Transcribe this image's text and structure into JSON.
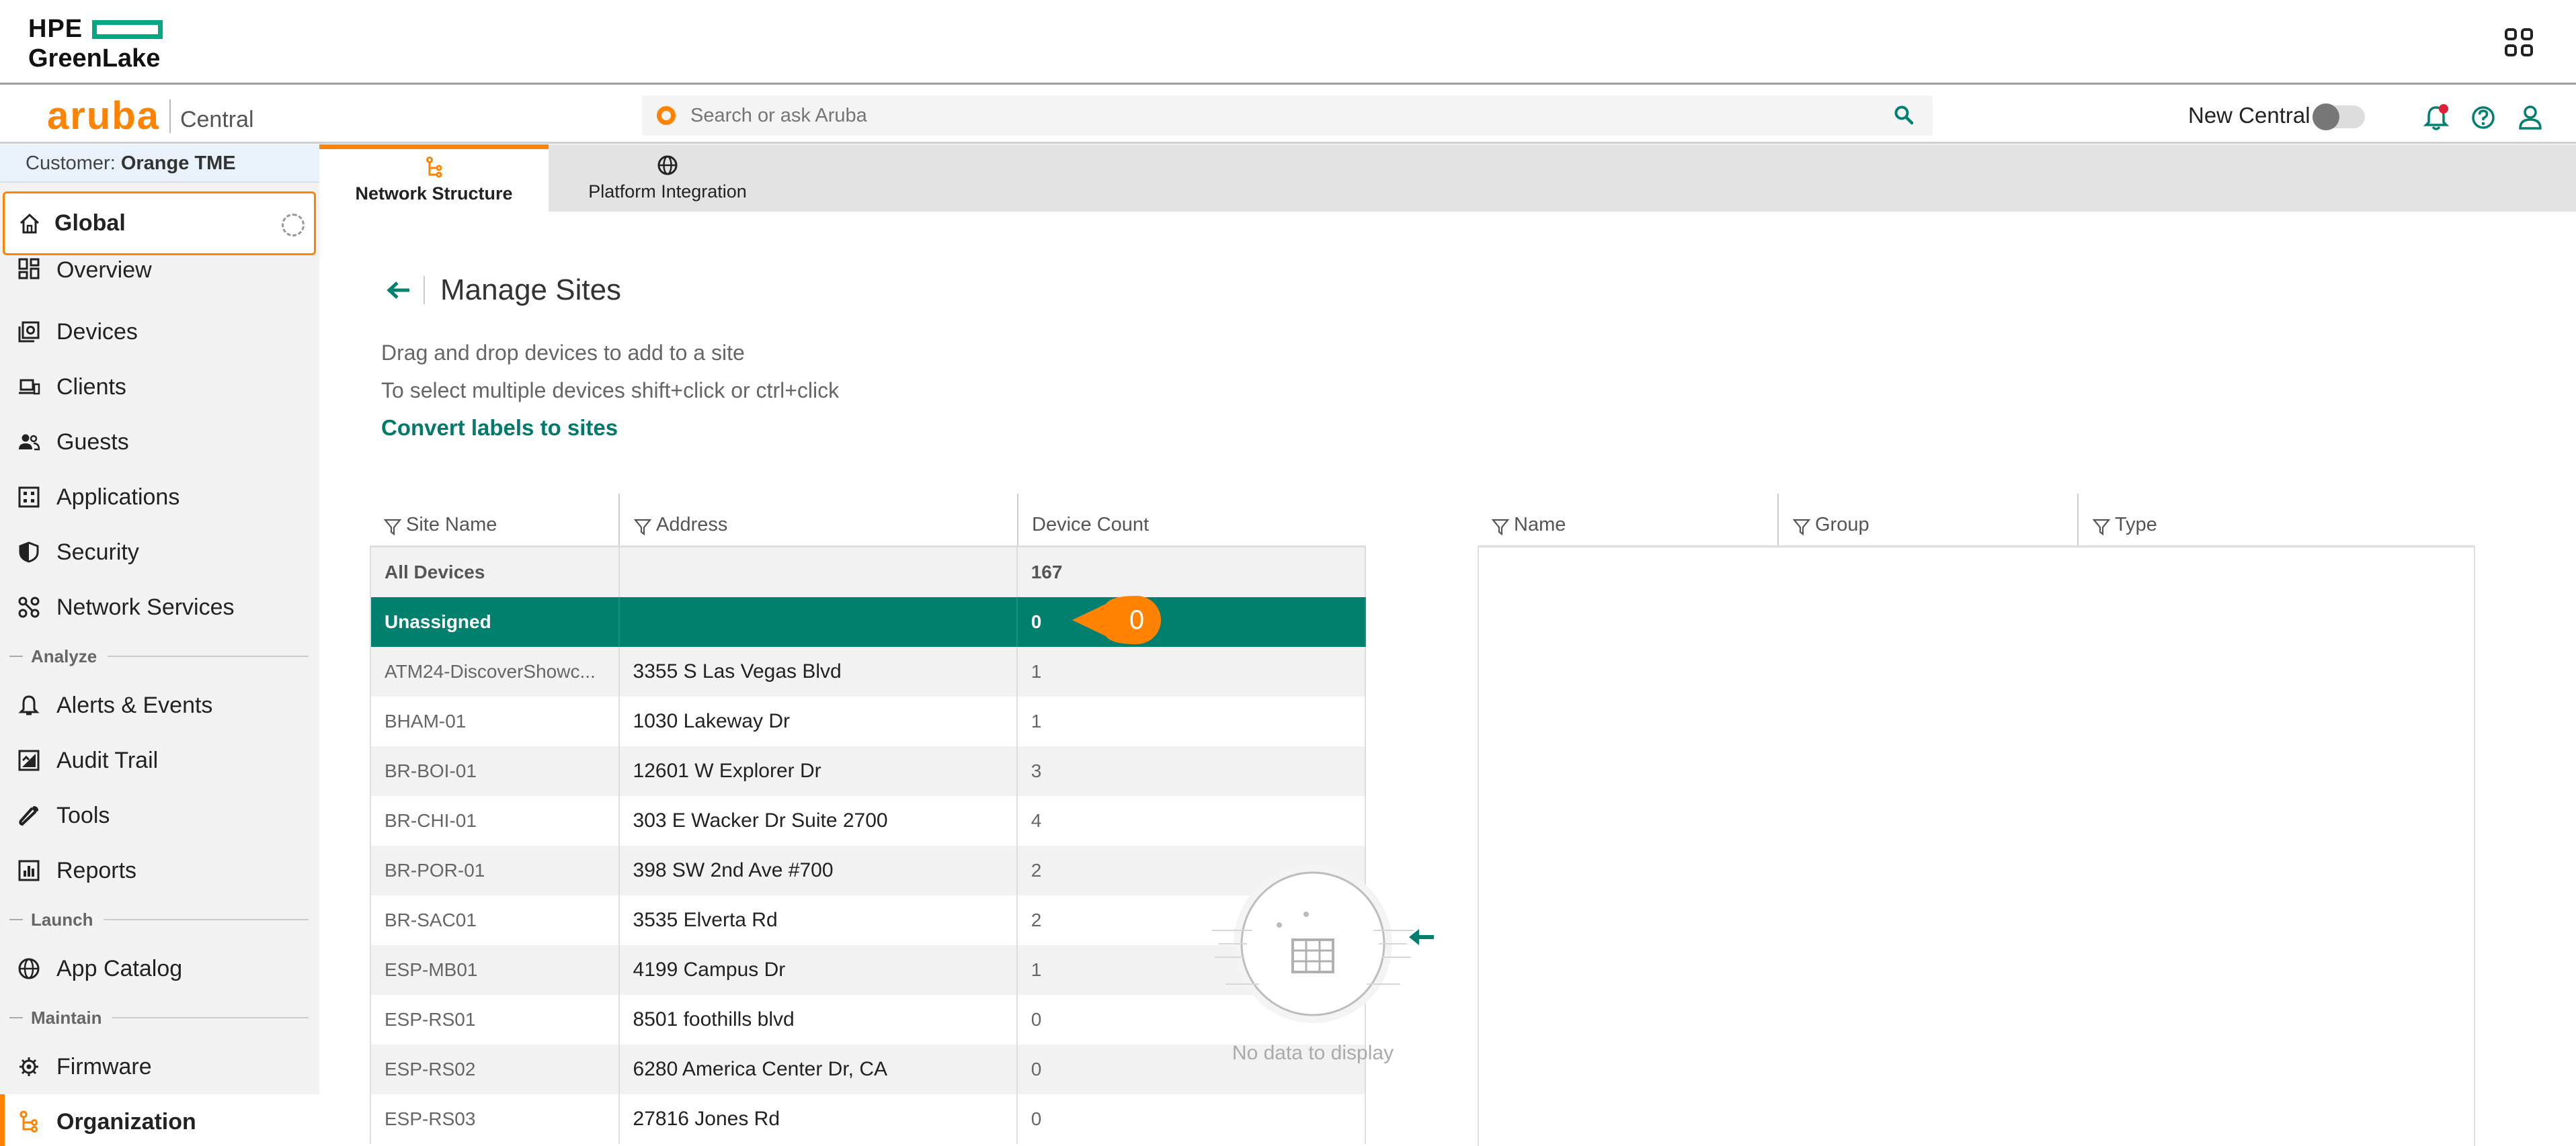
{
  "hpe": {
    "brand_top": "HPE",
    "brand_bottom": "GreenLake"
  },
  "aruba": {
    "logo": "aruba",
    "product": "Central"
  },
  "search": {
    "placeholder": "Search or ask Aruba"
  },
  "header": {
    "new_central_label": "New Central",
    "new_central_on": false
  },
  "customer": {
    "prefix": "Customer:",
    "name": "Orange TME"
  },
  "scope": {
    "label": "Global"
  },
  "nav": {
    "overview": "Overview",
    "devices": "Devices",
    "clients": "Clients",
    "guests": "Guests",
    "applications": "Applications",
    "security": "Security",
    "network_services": "Network Services",
    "section_analyze": "Analyze",
    "alerts": "Alerts & Events",
    "audit": "Audit Trail",
    "tools": "Tools",
    "reports": "Reports",
    "section_launch": "Launch",
    "app_catalog": "App Catalog",
    "section_maintain": "Maintain",
    "firmware": "Firmware",
    "organization": "Organization"
  },
  "tabs": {
    "network_structure": "Network Structure",
    "platform_integration": "Platform Integration"
  },
  "page": {
    "title": "Manage Sites",
    "hint1": "Drag and drop devices to add to a site",
    "hint2": "To select multiple devices shift+click or ctrl+click",
    "convert_link": "Convert labels to sites"
  },
  "sites_table": {
    "columns": {
      "name": "Site Name",
      "address": "Address",
      "count": "Device Count"
    },
    "rows": [
      {
        "name": "All Devices",
        "address": "",
        "count": "167"
      },
      {
        "name": "Unassigned",
        "address": "",
        "count": "0"
      },
      {
        "name": "ATM24-DiscoverShowc...",
        "address": "3355 S Las Vegas Blvd",
        "count": "1"
      },
      {
        "name": "BHAM-01",
        "address": "1030 Lakeway Dr",
        "count": "1"
      },
      {
        "name": "BR-BOI-01",
        "address": "12601 W Explorer Dr",
        "count": "3"
      },
      {
        "name": "BR-CHI-01",
        "address": "303 E Wacker Dr Suite 2700",
        "count": "4"
      },
      {
        "name": "BR-POR-01",
        "address": "398 SW 2nd Ave #700",
        "count": "2"
      },
      {
        "name": "BR-SAC01",
        "address": "3535 Elverta Rd",
        "count": "2"
      },
      {
        "name": "ESP-MB01",
        "address": "4199 Campus Dr",
        "count": "1"
      },
      {
        "name": "ESP-RS01",
        "address": "8501 foothills blvd",
        "count": "0"
      },
      {
        "name": "ESP-RS02",
        "address": "6280 America Center Dr, CA",
        "count": "0"
      },
      {
        "name": "ESP-RS03",
        "address": "27816 Jones Rd",
        "count": "0"
      }
    ]
  },
  "callout": {
    "value": "0"
  },
  "devices_table": {
    "columns": {
      "name": "Name",
      "group": "Group",
      "type": "Type"
    },
    "empty_text": "No data to display"
  },
  "colors": {
    "accent": "#ff8300",
    "teal": "#01806f",
    "hpe_green": "#01a982"
  }
}
